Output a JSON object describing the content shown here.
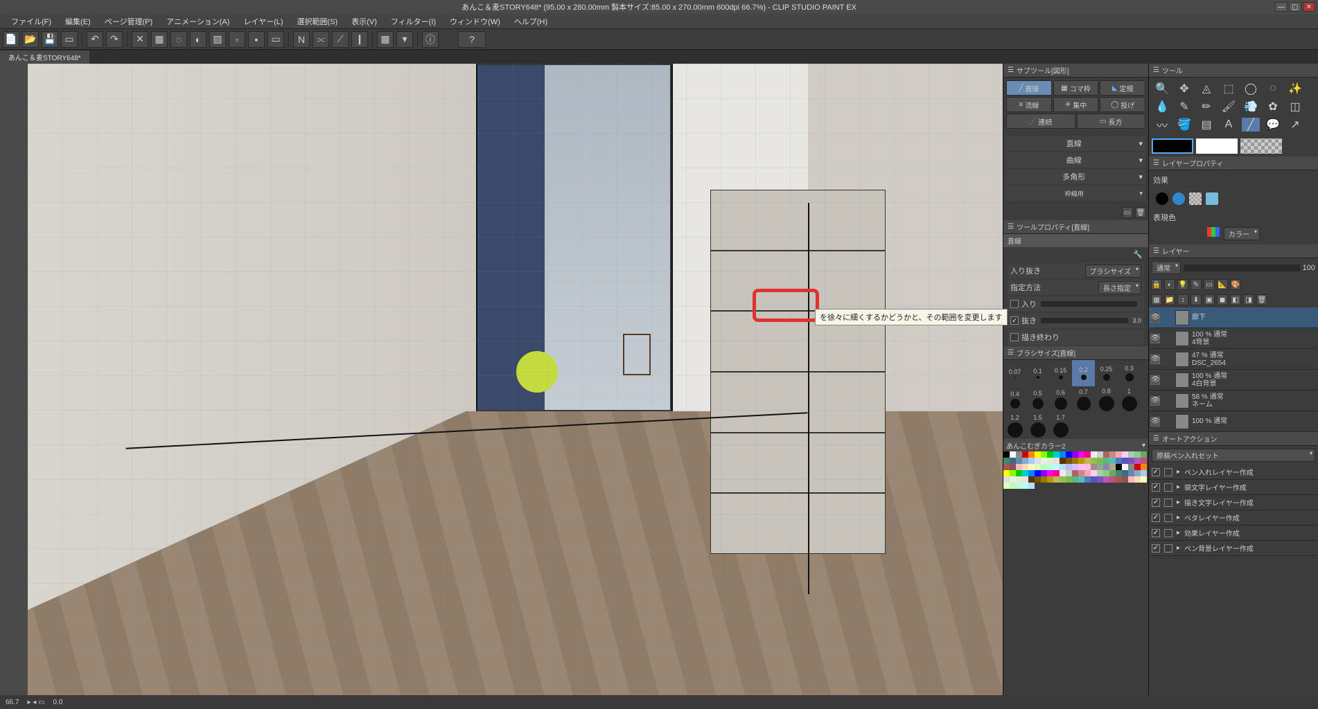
{
  "title": "あんこ＆麦STORY648* (95.00 x 280.00mm 製本サイズ:85.00 x 270.00mm 600dpi 66.7%) - CLIP STUDIO PAINT EX",
  "menu": [
    "ファイル(F)",
    "編集(E)",
    "ページ管理(P)",
    "アニメーション(A)",
    "レイヤー(L)",
    "選択範囲(S)",
    "表示(V)",
    "フィルター(I)",
    "ウィンドウ(W)",
    "ヘルプ(H)"
  ],
  "doc_tab": "あんこ＆麦STORY648*",
  "status_zoom": "66.7",
  "status_angle": "0.0",
  "subtool_panel": {
    "title": "サブツール[図形]",
    "tools": [
      "直接",
      "コマ枠",
      "定規",
      "流線",
      "集中",
      "投げ",
      "連続",
      "長方"
    ],
    "selected": 0,
    "list": [
      "直線",
      "曲線",
      "多角形",
      "枠線用"
    ]
  },
  "toolprop_panel": {
    "title": "ツールプロパティ[直線]",
    "heading": "直線",
    "rows": {
      "nuki_label": "入り抜き",
      "brush_label": "ブラシサイズ",
      "method_label": "指定方法",
      "method_value": "長さ指定",
      "in_label": "入り",
      "out_label": "抜き",
      "out_value": "3.0",
      "end_label": "描き終わり"
    }
  },
  "tooltip_text": "を徐々に細くするかどうかと、その範囲を変更します",
  "brush_size_panel": {
    "title": "ブラシサイズ[直線]",
    "sizes": [
      "0.07",
      "0.1",
      "0.15",
      "0.2",
      "0.25",
      "0.3",
      "0.4",
      "0.5",
      "0.6",
      "0.7",
      "0.8",
      "1",
      "1.2",
      "1.5",
      "1.7"
    ],
    "selected": 3
  },
  "swatch_panel": {
    "title": "あんこむぎカラー2"
  },
  "tool_panel_title": "ツール",
  "layerprop_panel": {
    "title": "レイヤープロパティ",
    "effect_label": "効果",
    "color_label": "表現色",
    "color_value": "カラー"
  },
  "layer_panel": {
    "title": "レイヤー",
    "blend": "通常",
    "opacity": "100",
    "rows": [
      {
        "percent": "",
        "name": "廊下",
        "sel": true
      },
      {
        "percent": "100 % 通常",
        "name": "4背景"
      },
      {
        "percent": "47 % 通常",
        "name": "DSC_2654"
      },
      {
        "percent": "100 % 通常",
        "name": "4白背景"
      },
      {
        "percent": "58 % 通常",
        "name": "ネーム"
      },
      {
        "percent": "100 % 通常",
        "name": ""
      }
    ]
  },
  "autoaction_panel": {
    "title": "オートアクション",
    "set": "原稿ペン入れセット",
    "actions": [
      "ペン入れレイヤー作成",
      "袋文字レイヤー作成",
      "描き文字レイヤー作成",
      "ベタレイヤー作成",
      "効果レイヤー作成",
      "ペン背景レイヤー作成"
    ]
  },
  "swatch_colors": [
    "#000",
    "#fff",
    "#888",
    "#c00",
    "#f80",
    "#ff0",
    "#8f0",
    "#0c0",
    "#0cc",
    "#08f",
    "#00f",
    "#80f",
    "#f0f",
    "#f08",
    "#eee",
    "#ccc",
    "#a66",
    "#c88",
    "#eaa",
    "#fcf",
    "#aca",
    "#8c8",
    "#6a6",
    "#486",
    "#468",
    "#68a",
    "#8ac",
    "#ace",
    "#dde",
    "#eed",
    "#ded",
    "#edd",
    "#530",
    "#750",
    "#970",
    "#b90",
    "#bb5",
    "#9b5",
    "#7b5",
    "#5b7",
    "#5bb",
    "#57b",
    "#55b",
    "#75b",
    "#b5b",
    "#b57",
    "#a55",
    "#855",
    "#fbb",
    "#fdb",
    "#ffb",
    "#dfb",
    "#bfb",
    "#bfd",
    "#bff",
    "#bdf",
    "#bbf",
    "#dbf",
    "#fbf",
    "#fbd",
    "#a88",
    "#8a8",
    "#88a",
    "#aa8"
  ]
}
